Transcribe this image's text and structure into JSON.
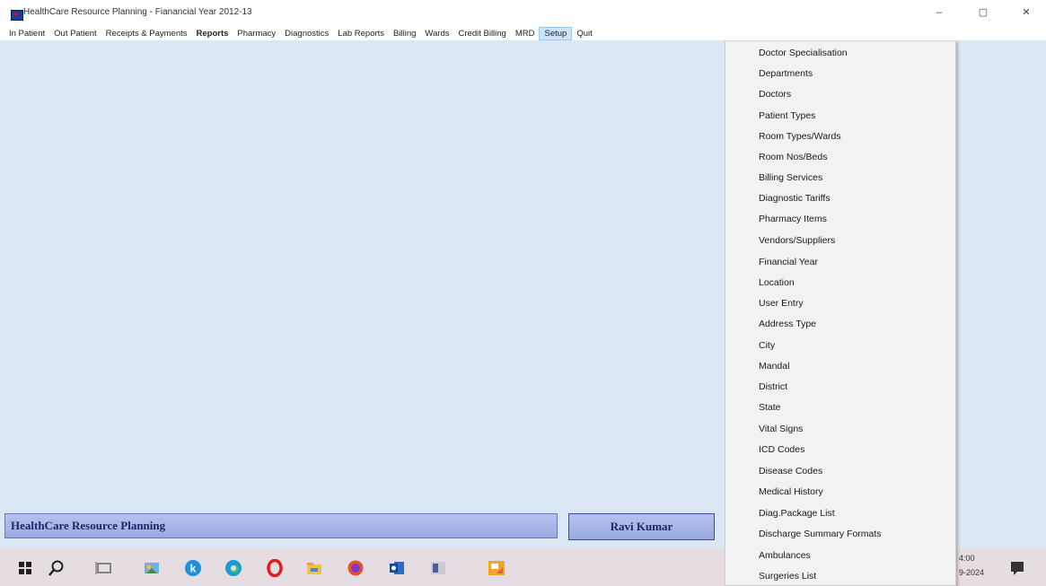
{
  "window": {
    "title": "HealthCare Resource Planning - Fianancial Year 2012-13",
    "minimize": "–",
    "maximize": "▢",
    "close": "✕"
  },
  "menubar": {
    "items": [
      "In Patient",
      "Out Patient",
      "Receipts & Payments",
      "Reports",
      "Pharmacy",
      "Diagnostics",
      "Lab Reports",
      "Billing",
      "Wards",
      "Credit Billing",
      "MRD",
      "Setup",
      "Quit"
    ]
  },
  "setup_menu": {
    "items": [
      "Doctor Specialisation",
      "Departments",
      "Doctors",
      "Patient Types",
      "Room Types/Wards",
      "Room Nos/Beds",
      "Billing Services",
      "Diagnostic Tariffs",
      "Pharmacy Items",
      "Vendors/Suppliers",
      "Financial Year",
      "Location",
      "User Entry",
      "Address Type",
      "City",
      "Mandal",
      "District",
      "State",
      "Vital Signs",
      "ICD Codes",
      "Disease Codes",
      "Medical History",
      "Diag.Package List",
      "Discharge Summary Formats",
      "Ambulances",
      "Surgeries List"
    ]
  },
  "status": {
    "app_name": "HealthCare Resource Planning",
    "user": "Ravi Kumar"
  },
  "tray": {
    "time": "4:00",
    "date": "9-2024"
  },
  "colors": {
    "main_bg": "#dce7f5",
    "status_panel": "#aab6e8",
    "menu_highlight": "#cce4f7",
    "taskbar": "#e6dde2"
  }
}
